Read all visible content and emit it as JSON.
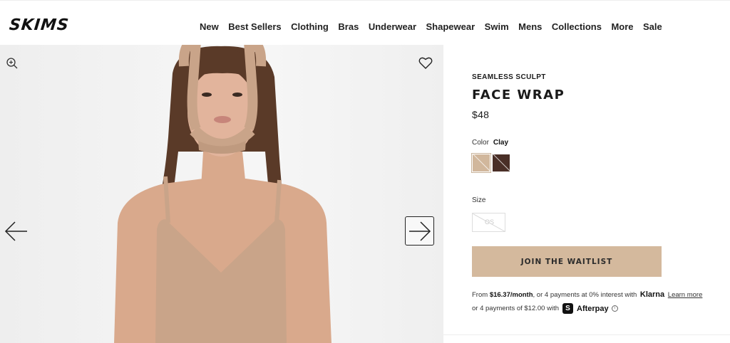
{
  "header": {
    "logo": "SKIMS",
    "nav": [
      "New",
      "Best Sellers",
      "Clothing",
      "Bras",
      "Underwear",
      "Shapewear",
      "Swim",
      "Mens",
      "Collections",
      "More",
      "Sale"
    ]
  },
  "gallery": {
    "icons": {
      "zoom": "zoom-in-icon",
      "favorite": "heart-icon",
      "prev": "arrow-left-icon",
      "next": "arrow-right-icon"
    }
  },
  "product": {
    "collection": "SEAMLESS SCULPT",
    "title": "FACE WRAP",
    "price": "$48",
    "color_label": "Color",
    "color_selected": "Clay",
    "colors": [
      {
        "name": "Clay",
        "hex": "#d1b79c"
      },
      {
        "name": "Cocoa",
        "hex": "#4a2f27"
      }
    ],
    "size_label": "Size",
    "sizes": [
      {
        "label": "OS",
        "available": false
      }
    ],
    "cta": "JOIN THE WAITLIST",
    "klarna": {
      "prefix": "From ",
      "amount": "$16.37/month",
      "middle": ", or 4 payments at 0% interest with ",
      "brand": "Klarna",
      "link": "Learn more"
    },
    "afterpay": {
      "text": "or 4 payments of $12.00 with",
      "badge": "S",
      "brand": "Afterpay",
      "info": "i"
    }
  },
  "colors": {
    "cta_bg": "#d4b99d",
    "text": "#1a1a1a"
  }
}
